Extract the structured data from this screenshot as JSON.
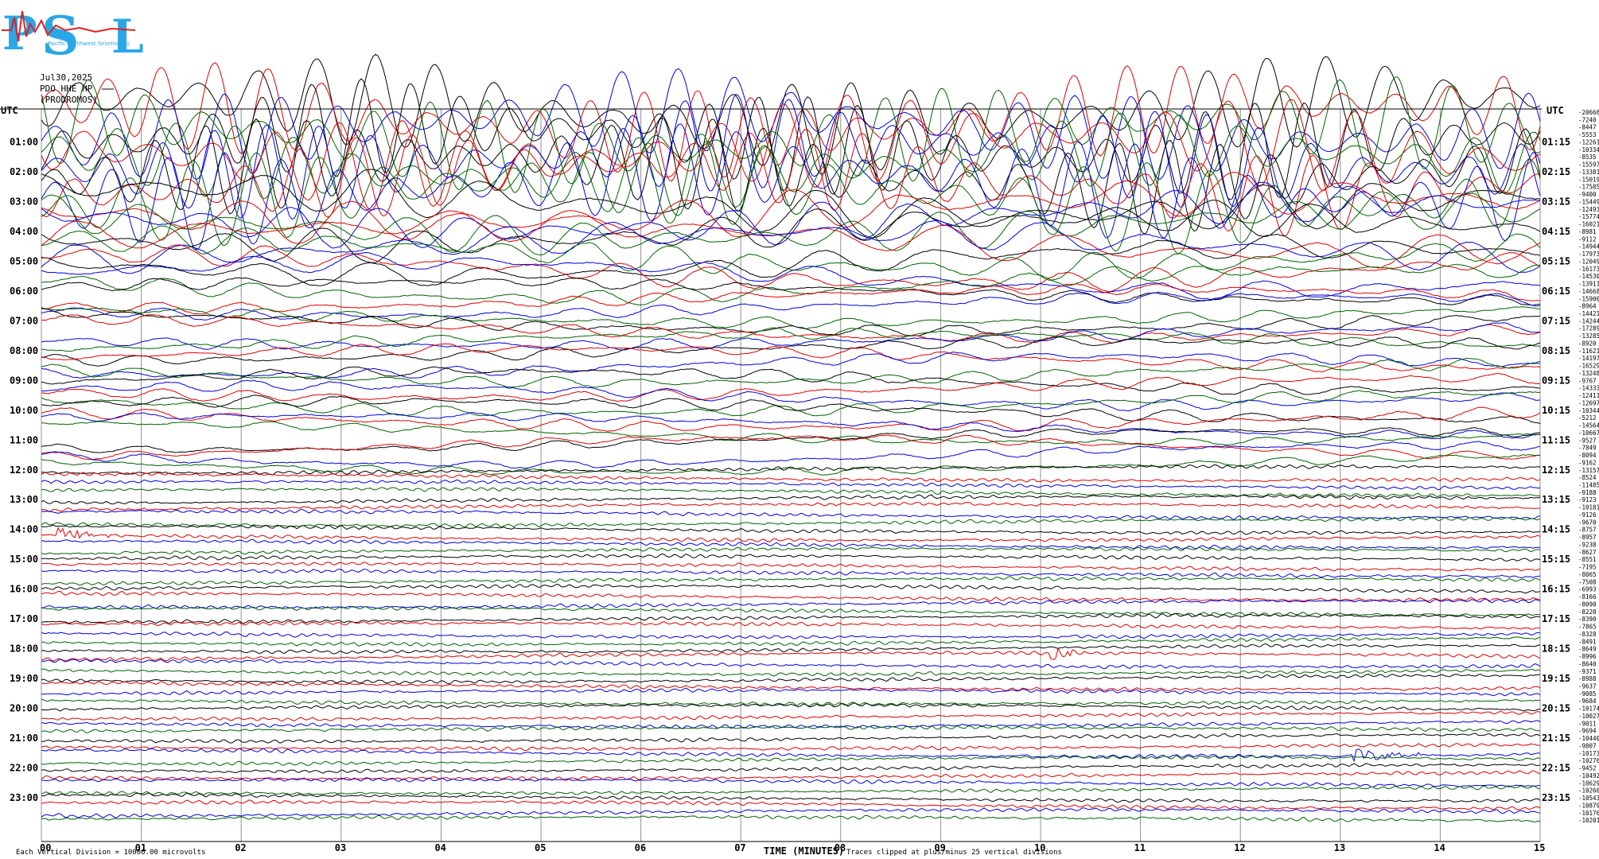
{
  "logo": {
    "letters": [
      "P",
      "S",
      "L"
    ],
    "tagline": "Pacific Northwest Seismology"
  },
  "header": {
    "date": "Jul30,2025",
    "station": "PDO HHE HP",
    "note": "(PRODROMOS)"
  },
  "left_axis_title": "UTC",
  "right_axis_title": "UTC",
  "x_axis_title": "TIME (MINUTES)",
  "footer_left": "Each Vertical Division = 10000.00 microvolts",
  "footer_right": "Traces clipped at plus/minus 25 vertical divisions",
  "colors": {
    "trace_cycle": [
      "#000000",
      "#e00000",
      "#0000e0",
      "#006400"
    ],
    "grid": "#909090",
    "text": "#000000"
  },
  "chart_data": {
    "type": "line",
    "title": "",
    "xlabel": "TIME (MINUTES)",
    "ylabel": "",
    "xlim": [
      0,
      15
    ],
    "x_ticks": [
      "00",
      "01",
      "02",
      "03",
      "04",
      "05",
      "06",
      "07",
      "08",
      "09",
      "10",
      "11",
      "12",
      "13",
      "14",
      "15"
    ],
    "hour_labels_left": [
      "01:00",
      "02:00",
      "03:00",
      "04:00",
      "05:00",
      "06:00",
      "07:00",
      "08:00",
      "09:00",
      "10:00",
      "11:00",
      "12:00",
      "13:00",
      "14:00",
      "15:00",
      "16:00",
      "17:00",
      "18:00",
      "19:00",
      "20:00",
      "21:00",
      "22:00",
      "23:00"
    ],
    "hour_labels_right": [
      "01:15",
      "02:15",
      "03:15",
      "04:15",
      "05:15",
      "06:15",
      "07:15",
      "08:15",
      "09:15",
      "10:15",
      "11:15",
      "12:15",
      "13:15",
      "14:15",
      "15:15",
      "16:15",
      "17:15",
      "18:15",
      "19:15",
      "20:15",
      "21:15",
      "22:15",
      "23:15"
    ],
    "trace_count": 96,
    "minutes_per_trace": 15,
    "microvolts_per_division": 10000.0,
    "clip_divisions": 25,
    "right_values": [
      "-20666",
      "-7240",
      "-8447",
      "-5553",
      "-12261",
      "-10334",
      "-8535",
      "-15597",
      "-13381",
      "-15019",
      "-17585",
      "-9400",
      "-15449",
      "-12493",
      "-15774",
      "-16021",
      "-8981",
      "-9112",
      "-14944",
      "-17973",
      "-12049",
      "-16173",
      "-14530",
      "-13911",
      "-14668",
      "-15900",
      "-8964",
      "-14421",
      "-14244",
      "-17289",
      "-13285",
      "-8920",
      "-11621",
      "-14197",
      "-16529",
      "-13248",
      "-9767",
      "-14333",
      "-12411",
      "-12697",
      "-10344",
      "-5212",
      "-14564",
      "-10667",
      "-9527",
      "-7849",
      "-8094",
      "-9162",
      "-13157",
      "-8524",
      "-11485",
      "-9188",
      "-9123",
      "-10181",
      "-9126",
      "-9670",
      "-8757",
      "-8957",
      "-9238",
      "-8627",
      "-8551",
      "-7195",
      "-8065",
      "-7508",
      "-6993",
      "-8166",
      "-8090",
      "-8220",
      "-8390",
      "-7865",
      "-8328",
      "-8491",
      "-8649",
      "-8996",
      "-8640",
      "-9371",
      "-8988",
      "-9637",
      "-9085",
      "-9684",
      "-10174",
      "-10027",
      "-9011",
      "-9694",
      "-10440",
      "-9807",
      "-10173",
      "-10276",
      "-9452",
      "-10492",
      "-10629",
      "-10260",
      "-10543",
      "-10879",
      "-10176",
      "-10201"
    ],
    "events": [
      {
        "trace": 57,
        "minute_start": 0.15,
        "minute_end": 0.9,
        "note": ""
      },
      {
        "trace": 73,
        "minute_start": 10.1,
        "minute_end": 10.6,
        "note": ""
      },
      {
        "trace": 86,
        "minute_start": 13.1,
        "minute_end": 14.3,
        "note": ""
      }
    ]
  }
}
